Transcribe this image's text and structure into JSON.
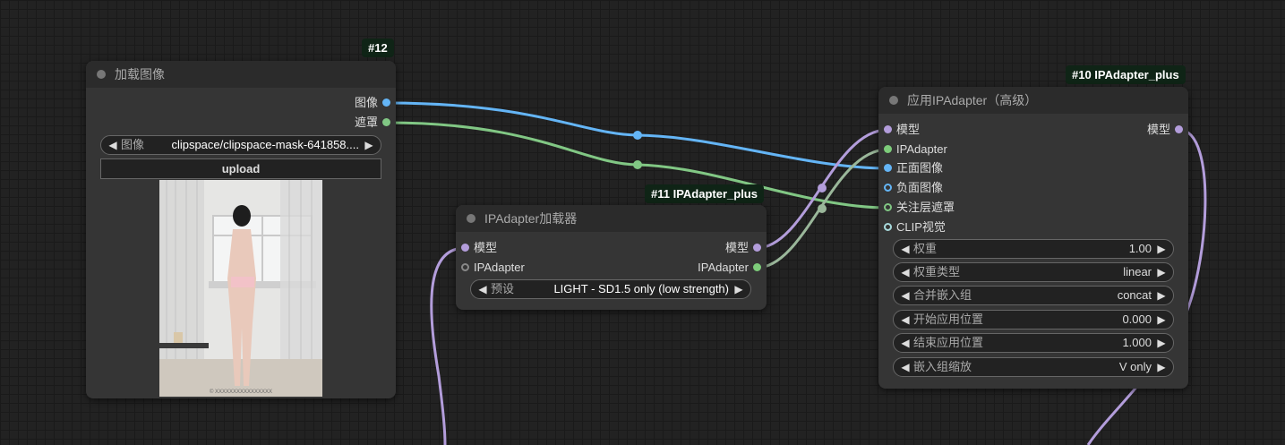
{
  "colors": {
    "model": "#b39ddb",
    "ipadapter": "#7dcc7a",
    "image": "#64b5f6",
    "mask": "#81c784",
    "clip_vision": "#a8dadc",
    "badge_bg": "#0f2416"
  },
  "load_image_node": {
    "badge": "#12",
    "title": "加载图像",
    "outputs": [
      "图像",
      "遮罩"
    ],
    "image_widget": {
      "label": "图像",
      "value": "clipspace/clipspace-mask-641858...."
    },
    "upload_label": "upload",
    "preview_caption": "© XXXXXXXXXXXXXXXX"
  },
  "loader_node": {
    "badge": "#11 IPAdapter_plus",
    "title": "IPAdapter加载器",
    "inputs": [
      "模型",
      "IPAdapter"
    ],
    "outputs": [
      "模型",
      "IPAdapter"
    ],
    "preset_widget": {
      "label": "预设",
      "value": "LIGHT - SD1.5 only (low strength)"
    }
  },
  "apply_node": {
    "badge": "#10 IPAdapter_plus",
    "title": "应用IPAdapter（高级）",
    "inputs": [
      "模型",
      "IPAdapter",
      "正面图像",
      "负面图像",
      "关注层遮罩",
      "CLIP视觉"
    ],
    "outputs": [
      "模型"
    ],
    "widgets": [
      {
        "label": "权重",
        "value": "1.00"
      },
      {
        "label": "权重类型",
        "value": "linear"
      },
      {
        "label": "合并嵌入组",
        "value": "concat"
      },
      {
        "label": "开始应用位置",
        "value": "0.000"
      },
      {
        "label": "结束应用位置",
        "value": "1.000"
      },
      {
        "label": "嵌入组缩放",
        "value": "V only"
      }
    ]
  }
}
